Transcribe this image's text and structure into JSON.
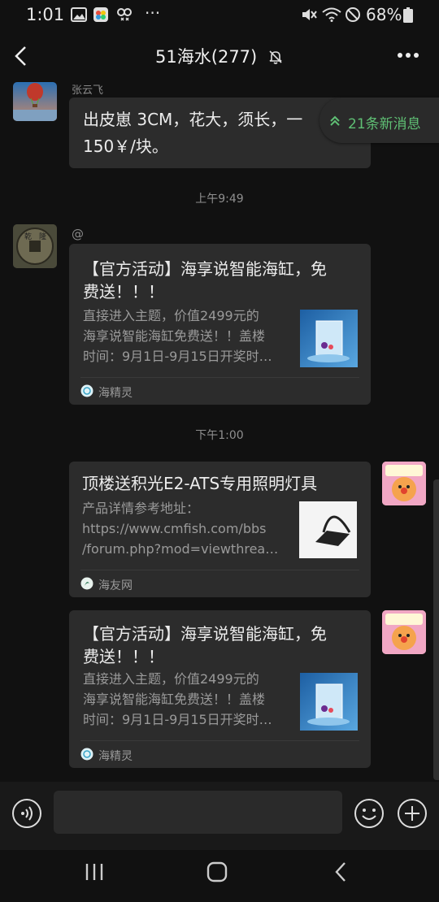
{
  "status_bar": {
    "time": "1:01",
    "ellipsis": "···",
    "battery": "68%"
  },
  "header": {
    "title": "51海水(277)",
    "back_icon": "chevron-left-icon",
    "mute_icon": "bell-off-icon",
    "more_icon": "more-dots-icon"
  },
  "new_messages_badge": "21条新消息",
  "messages": [
    {
      "sender": "张云飞",
      "text_line1": "出皮崽 3CM，花大，须长，一",
      "text_line2": "150￥/块。"
    }
  ],
  "time_separators": [
    "上午9:49",
    "下午1:00"
  ],
  "cards": [
    {
      "sender": "@",
      "title_line1": "【官方活动】海享说智能海缸，免",
      "title_line2": "费送！！！",
      "desc": [
        "直接进入主题，价值2499元的",
        "海享说智能海缸免费送！！盖楼",
        "时间：9月1日-9月15日开奖时…"
      ],
      "source": "海精灵"
    },
    {
      "title_line1": "顶楼送积光E2-ATS专用照明灯具",
      "desc": [
        "产品详情参考地址：",
        "https://www.cmfish.com/bbs",
        "/forum.php?mod=viewthrea…"
      ],
      "source": "海友网"
    },
    {
      "title_line1": "【官方活动】海享说智能海缸，免",
      "title_line2": "费送！！！",
      "desc": [
        "直接进入主题，价值2499元的",
        "海享说智能海缸免费送！！盖楼",
        "时间：9月1日-9月15日开奖时…"
      ],
      "source": "海精灵"
    }
  ],
  "input_bar": {
    "voice_icon": "voice-icon",
    "emoji_icon": "emoji-icon",
    "plus_icon": "plus-icon"
  },
  "colors": {
    "background": "#111111",
    "bubble": "#2c2c2c",
    "accent_green": "#5fbf74"
  }
}
